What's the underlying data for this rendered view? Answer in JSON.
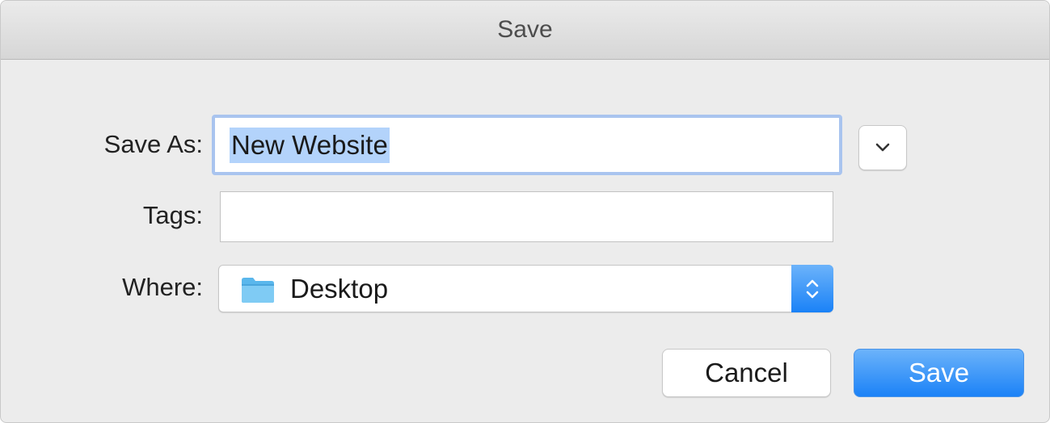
{
  "window": {
    "title": "Save"
  },
  "form": {
    "save_as": {
      "label": "Save As:",
      "value": "New Website"
    },
    "tags": {
      "label": "Tags:",
      "value": ""
    },
    "where": {
      "label": "Where:",
      "selected": "Desktop",
      "icon": "folder-icon"
    }
  },
  "buttons": {
    "cancel_label": "Cancel",
    "save_label": "Save"
  },
  "colors": {
    "accent": "#1a82f7",
    "selection": "#b3d3fb",
    "focus_ring": "#a9c4ef",
    "folder": "#5ab7ec"
  }
}
